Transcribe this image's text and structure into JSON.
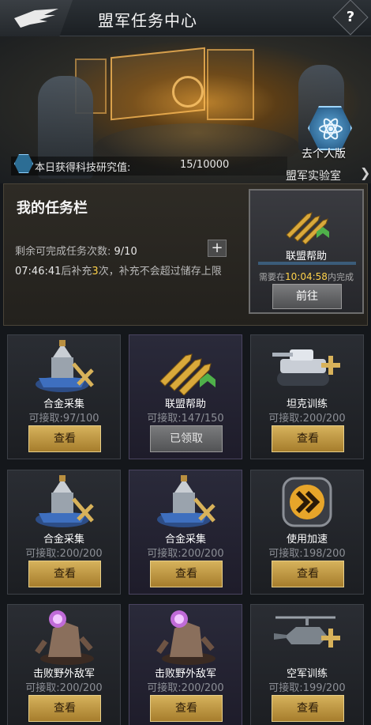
{
  "header": {
    "title": "盟军任务中心",
    "help_glyph": "?"
  },
  "banner": {
    "personal_label": "去个人版",
    "science_label": "本日获得科技研究值:",
    "science_value": "15/10000",
    "lab_link": "盟军实验室",
    "lab_arrow": "❯"
  },
  "my_tasks": {
    "title": "我的任务栏",
    "remain_label": "剩余可完成任务次数:",
    "remain_value": "9/10",
    "refill_time": "07:46:41",
    "refill_mid": "后补充",
    "refill_count": "3",
    "refill_tail": "次，补充不会超过储存上限",
    "plus_glyph": "+",
    "featured": {
      "name": "联盟帮助",
      "need_prefix": "需要在",
      "need_time": "10:04:58",
      "need_suffix": "内完成",
      "go_label": "前往"
    }
  },
  "cards": [
    {
      "name": "合金采集",
      "progress": "可接取:97/100",
      "button": "查看",
      "icon": "alloy-extractor-icon"
    },
    {
      "name": "联盟帮助",
      "progress": "可接取:147/150",
      "button": "已领取",
      "icon": "bullets-icon"
    },
    {
      "name": "坦克训练",
      "progress": "可接取:200/200",
      "button": "查看",
      "icon": "tank-icon"
    },
    {
      "name": "合金采集",
      "progress": "可接取:200/200",
      "button": "查看",
      "icon": "alloy-extractor-icon"
    },
    {
      "name": "合金采集",
      "progress": "可接取:200/200",
      "button": "查看",
      "icon": "alloy-extractor-icon"
    },
    {
      "name": "使用加速",
      "progress": "可接取:198/200",
      "button": "查看",
      "icon": "speedup-icon"
    },
    {
      "name": "击败野外敌军",
      "progress": "可接取:200/200",
      "button": "查看",
      "icon": "mutant-enemy-icon"
    },
    {
      "name": "击败野外敌军",
      "progress": "可接取:200/200",
      "button": "查看",
      "icon": "mutant-enemy-icon"
    },
    {
      "name": "空军训练",
      "progress": "可接取:199/200",
      "button": "查看",
      "icon": "helicopter-icon"
    }
  ]
}
